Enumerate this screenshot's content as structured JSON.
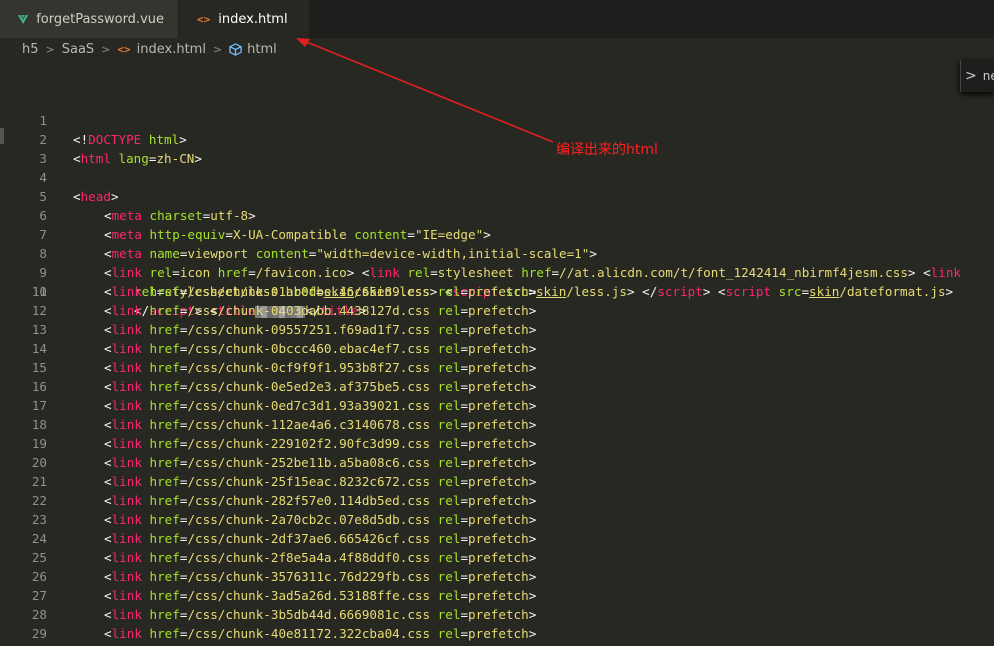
{
  "tabs": [
    {
      "label": "forgetPassword.vue",
      "icon": "vue-icon",
      "active": false
    },
    {
      "label": "index.html",
      "icon": "html-icon",
      "active": true,
      "modified": true
    }
  ],
  "breadcrumb": {
    "items": [
      "h5",
      "SaaS",
      "index.html",
      "html"
    ],
    "file_icon_glyph": "<>",
    "element_icon": "cube-icon"
  },
  "find_widget": {
    "text": "ne",
    "chevron": ">"
  },
  "annotation": "编译出来的html",
  "colors": {
    "tag": "#f92672",
    "attr": "#a6e22e",
    "string": "#e6db74",
    "annotation": "#ff2020"
  },
  "code_lines": [
    {
      "n": "1"
    },
    {
      "n": "2"
    },
    {
      "n": "3"
    },
    {
      "n": "4"
    },
    {
      "n": "5"
    },
    {
      "n": "6"
    },
    {
      "n": "7"
    },
    {
      "n": "8"
    },
    {
      "n": "9"
    },
    {
      "n": "10"
    },
    {
      "n": "11"
    },
    {
      "n": "12"
    },
    {
      "n": "13"
    },
    {
      "n": "14"
    },
    {
      "n": "15"
    },
    {
      "n": "16"
    },
    {
      "n": "17"
    },
    {
      "n": "18"
    },
    {
      "n": "19"
    },
    {
      "n": "20"
    },
    {
      "n": "21"
    },
    {
      "n": "22"
    },
    {
      "n": "23"
    },
    {
      "n": "24"
    },
    {
      "n": "25"
    },
    {
      "n": "26"
    },
    {
      "n": "27"
    },
    {
      "n": "28"
    },
    {
      "n": "29"
    }
  ],
  "code": {
    "l1": {
      "open": "<!",
      "tag": "DOCTYPE",
      "attr": " html",
      "close": ">"
    },
    "l2": {
      "open": "<",
      "tag": "html",
      "attr": " lang",
      "eq": "=",
      "val": "zh-CN",
      "close": ">"
    },
    "l4": {
      "open": "<",
      "tag": "head",
      "close": ">"
    },
    "l5": {
      "open": "<",
      "tag": "meta",
      "attr": " charset",
      "eq": "=",
      "val": "utf-8",
      "close": ">"
    },
    "l6": {
      "open": "<",
      "tag": "meta",
      "attr": " http-equiv",
      "eq": "=",
      "val": "X-UA-Compatible",
      "attr2": " content",
      "eq2": "=",
      "val2": "\"IE=edge\"",
      "close": ">"
    },
    "l7": {
      "open": "<",
      "tag": "meta",
      "attr": " name",
      "eq": "=",
      "val": "viewport",
      "attr2": " content",
      "eq2": "=",
      "val2": "\"width=device-width,initial-scale=1\"",
      "close": ">"
    },
    "l8": {
      "p1": "<",
      "t1": "link",
      "a1": " rel",
      "e1": "=",
      "v1": "icon",
      "a2": " href",
      "e2": "=",
      "v2": "/favicon.ico",
      "c1": ">",
      "p2": " <",
      "t2": "link",
      "a3": " rel",
      "e3": "=",
      "v3": "stylesheet",
      "a4": " href",
      "e4": "=",
      "v4": "//at.alicdn.com/t/font_1242414_nbirmf4jesm.css",
      "c2": ">",
      "p3": " <",
      "t3": "link"
    },
    "l9": {
      "a1": "rel",
      "e1": "=",
      "v1": "stylesheet/less",
      "a2": " href",
      "e2": "=",
      "v2a": "skin",
      "v2b": "/skin.less",
      "c1": ">",
      "p2": " <",
      "t2": "script",
      "a3": " src",
      "e3": "=",
      "v3a": "skin",
      "v3b": "/less.js",
      "c2": ">",
      "p3": " </",
      "t3": "script",
      "c3": ">",
      "p4": " <",
      "t4": "script",
      "a4": " src",
      "e4": "=",
      "v4a": "skin",
      "v4b": "/dateformat.js",
      "c4": ">"
    },
    "l10": {
      "p1": "</",
      "t1": "script",
      "c1": ">",
      "p2": " <",
      "t2": "title",
      "p3": "</",
      "t3": "title",
      "c3": ">"
    },
    "link_tag": "link",
    "href_attr": " href",
    "rel_attr": " rel",
    "prefetch": "prefetch",
    "chunks": [
      "/css/chunk-01ab0dbe.46c65e89.css",
      "/css/chunk-0403dabb.4438127d.css",
      "/css/chunk-09557251.f69ad1f7.css",
      "/css/chunk-0bccc460.ebac4ef7.css",
      "/css/chunk-0cf9f9f1.953b8f27.css",
      "/css/chunk-0e5ed2e3.af375be5.css",
      "/css/chunk-0ed7c3d1.93a39021.css",
      "/css/chunk-112ae4a6.c3140678.css",
      "/css/chunk-229102f2.90fc3d99.css",
      "/css/chunk-252be11b.a5ba08c6.css",
      "/css/chunk-25f15eac.8232c672.css",
      "/css/chunk-282f57e0.114db5ed.css",
      "/css/chunk-2a70cb2c.07e8d5db.css",
      "/css/chunk-2df37ae6.665426cf.css",
      "/css/chunk-2f8e5a4a.4f88ddf0.css",
      "/css/chunk-3576311c.76d229fb.css",
      "/css/chunk-3ad5a26d.53188ffe.css",
      "/css/chunk-3b5db44d.6669081c.css",
      "/css/chunk-40e81172.322cba04.css"
    ]
  }
}
